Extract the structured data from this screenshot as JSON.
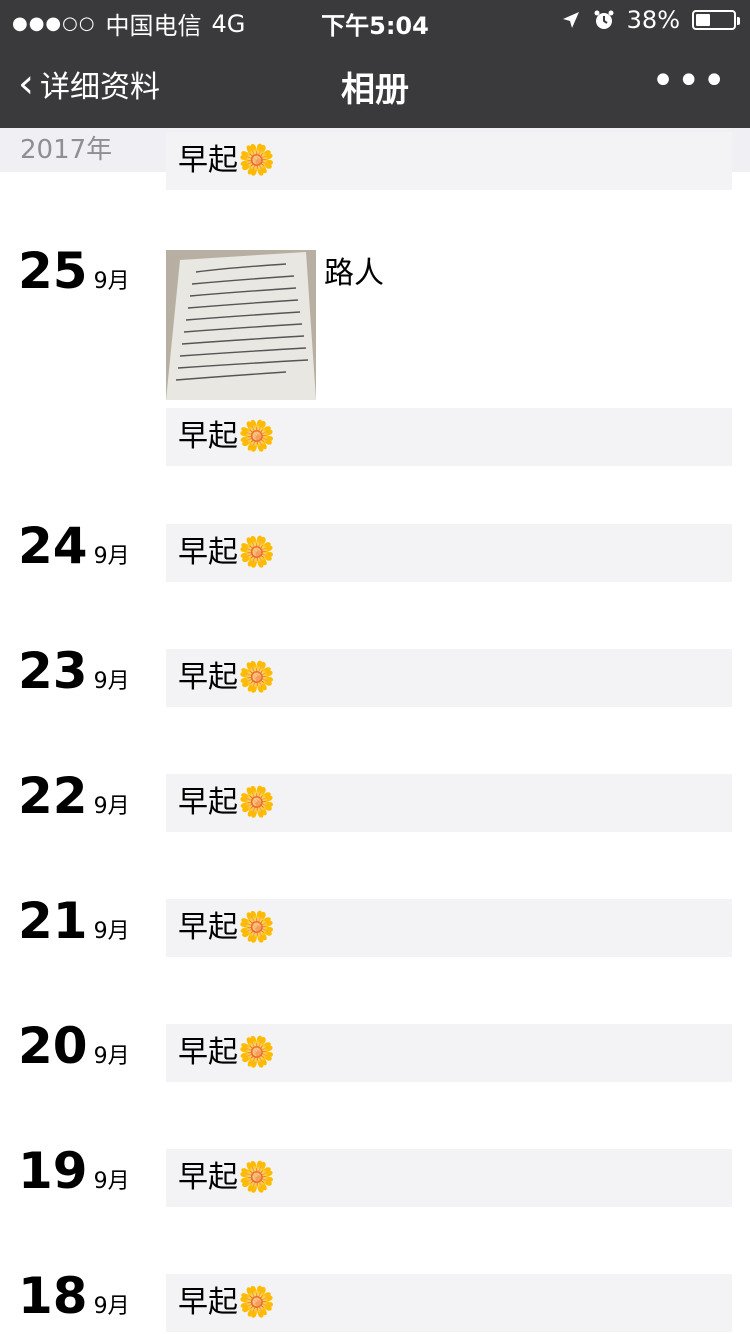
{
  "status": {
    "signal": "●●●○○",
    "carrier": "中国电信",
    "network": "4G",
    "time": "下午5:04",
    "battery_text": "38%",
    "battery_level": 0.38
  },
  "nav": {
    "back_label": "详细资料",
    "title": "相册",
    "more": "•••"
  },
  "year": "2017年",
  "entries": [
    {
      "day": "25",
      "month": "9月",
      "image_caption": "路人",
      "text": "早起"
    },
    {
      "day": "24",
      "month": "9月",
      "text": "早起"
    },
    {
      "day": "23",
      "month": "9月",
      "text": "早起"
    },
    {
      "day": "22",
      "month": "9月",
      "text": "早起"
    },
    {
      "day": "21",
      "month": "9月",
      "text": "早起"
    },
    {
      "day": "20",
      "month": "9月",
      "text": "早起"
    },
    {
      "day": "19",
      "month": "9月",
      "text": "早起"
    },
    {
      "day": "18",
      "month": "9月",
      "text": "早起"
    }
  ],
  "top_partial_text": "早起",
  "icons": {
    "sunflower": "sunflower-icon",
    "location": "location-arrow-icon",
    "alarm": "alarm-clock-icon",
    "back": "chevron-left-icon",
    "more": "more-dots-icon"
  },
  "colors": {
    "header_bg": "#3a3a3c",
    "year_band_bg": "#efeff4",
    "card_bg": "#f3f3f5"
  }
}
